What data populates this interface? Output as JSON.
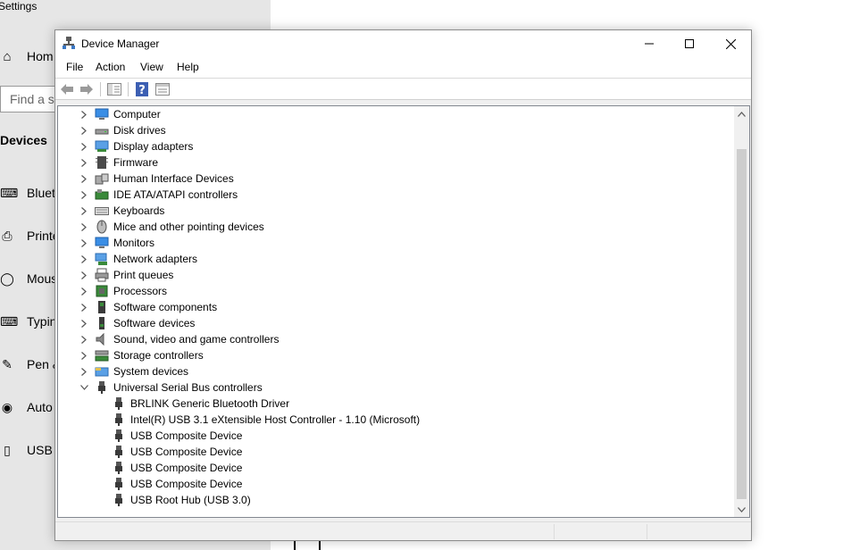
{
  "settings": {
    "title": "Settings",
    "home": "Hom",
    "search_placeholder": "Find a se",
    "section": "Devices",
    "items": [
      {
        "label": "Bluet",
        "icon": "bluetooth-icon"
      },
      {
        "label": "Printe",
        "icon": "printer-icon"
      },
      {
        "label": "Mous",
        "icon": "mouse-icon"
      },
      {
        "label": "Typin",
        "icon": "keyboard-icon"
      },
      {
        "label": "Pen &",
        "icon": "pen-icon"
      },
      {
        "label": "Auto",
        "icon": "autoplay-icon"
      },
      {
        "label": "USB",
        "icon": "usb-icon"
      }
    ]
  },
  "window": {
    "title": "Device Manager",
    "minimize": "—",
    "maximize": "☐",
    "close": "✕"
  },
  "menu": [
    "File",
    "Action",
    "View",
    "Help"
  ],
  "tree": {
    "categories": [
      {
        "label": "Computer",
        "icon": "computer-icon",
        "expanded": false
      },
      {
        "label": "Disk drives",
        "icon": "disk-drive-icon",
        "expanded": false
      },
      {
        "label": "Display adapters",
        "icon": "display-adapter-icon",
        "expanded": false
      },
      {
        "label": "Firmware",
        "icon": "firmware-icon",
        "expanded": false
      },
      {
        "label": "Human Interface Devices",
        "icon": "hid-icon",
        "expanded": false
      },
      {
        "label": "IDE ATA/ATAPI controllers",
        "icon": "ide-controller-icon",
        "expanded": false
      },
      {
        "label": "Keyboards",
        "icon": "keyboard-icon",
        "expanded": false
      },
      {
        "label": "Mice and other pointing devices",
        "icon": "mouse-icon",
        "expanded": false
      },
      {
        "label": "Monitors",
        "icon": "monitor-icon",
        "expanded": false
      },
      {
        "label": "Network adapters",
        "icon": "network-adapter-icon",
        "expanded": false
      },
      {
        "label": "Print queues",
        "icon": "printer-icon",
        "expanded": false
      },
      {
        "label": "Processors",
        "icon": "processor-icon",
        "expanded": false
      },
      {
        "label": "Software components",
        "icon": "software-component-icon",
        "expanded": false
      },
      {
        "label": "Software devices",
        "icon": "software-device-icon",
        "expanded": false
      },
      {
        "label": "Sound, video and game controllers",
        "icon": "speaker-icon",
        "expanded": false
      },
      {
        "label": "Storage controllers",
        "icon": "storage-controller-icon",
        "expanded": false
      },
      {
        "label": "System devices",
        "icon": "system-device-icon",
        "expanded": false
      },
      {
        "label": "Universal Serial Bus controllers",
        "icon": "usb-icon",
        "expanded": true
      }
    ],
    "usb_children": [
      "BRLINK Generic Bluetooth Driver",
      "Intel(R) USB 3.1 eXtensible Host Controller - 1.10 (Microsoft)",
      "USB Composite Device",
      "USB Composite Device",
      "USB Composite Device",
      "USB Composite Device",
      "USB Root Hub (USB 3.0)"
    ]
  },
  "colors": {
    "window_bg": "#f0f0f0",
    "tree_bg": "#ffffff",
    "scroll_thumb": "#cdcdcd",
    "settings_bg": "#e6e6e6"
  }
}
